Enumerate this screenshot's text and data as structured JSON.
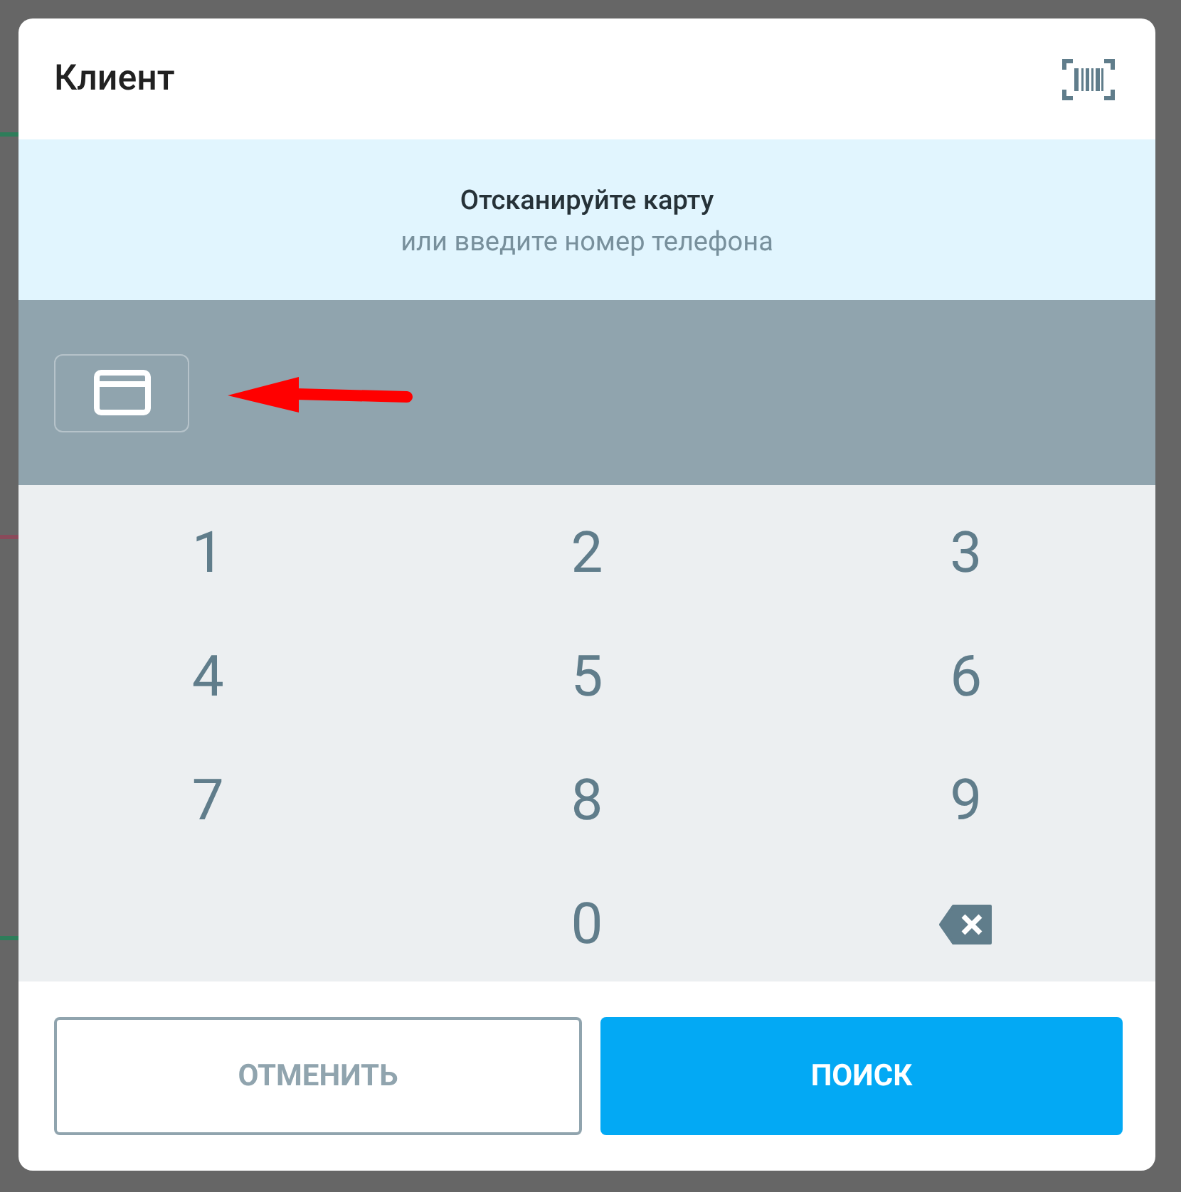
{
  "dialog": {
    "title": "Клиент",
    "prompt": {
      "title": "Отсканируйте карту",
      "subtitle": "или введите номер телефона"
    },
    "keys": [
      {
        "kind": "digit",
        "label": "1"
      },
      {
        "kind": "digit",
        "label": "2"
      },
      {
        "kind": "digit",
        "label": "3"
      },
      {
        "kind": "digit",
        "label": "4"
      },
      {
        "kind": "digit",
        "label": "5"
      },
      {
        "kind": "digit",
        "label": "6"
      },
      {
        "kind": "digit",
        "label": "7"
      },
      {
        "kind": "digit",
        "label": "8"
      },
      {
        "kind": "digit",
        "label": "9"
      },
      {
        "kind": "blank"
      },
      {
        "kind": "digit",
        "label": "0"
      },
      {
        "kind": "backspace"
      }
    ],
    "buttons": [
      {
        "label": "ОТМЕНИТЬ",
        "kind": "secondary"
      },
      {
        "label": "ПОИСК",
        "kind": "primary"
      }
    ]
  }
}
